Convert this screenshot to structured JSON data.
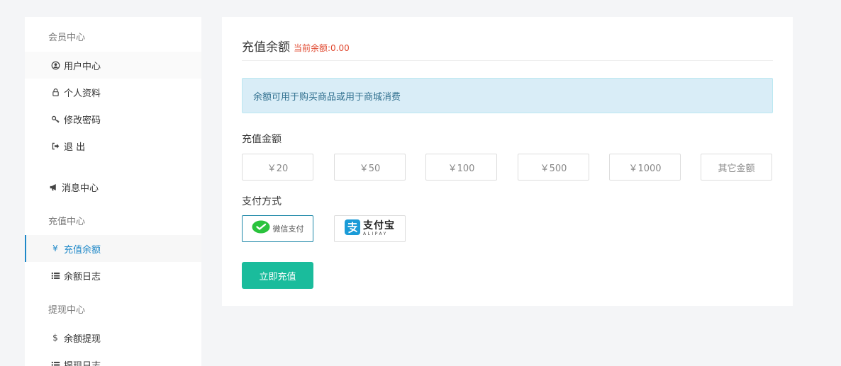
{
  "sidebar": {
    "sections": [
      {
        "title": "会员中心",
        "items": [
          {
            "label": "用户中心",
            "icon": "user-circle-icon"
          },
          {
            "label": "个人资料",
            "icon": "lock-icon"
          },
          {
            "label": "修改密码",
            "icon": "key-icon"
          },
          {
            "label": "退 出",
            "icon": "sign-out-icon"
          }
        ]
      },
      {
        "title": "",
        "items": [
          {
            "label": "消息中心",
            "icon": "bullhorn-icon"
          }
        ]
      },
      {
        "title": "充值中心",
        "items": [
          {
            "label": "充值余额",
            "icon": "yen-icon",
            "glyph": "¥"
          },
          {
            "label": "余额日志",
            "icon": "list-icon"
          }
        ]
      },
      {
        "title": "提现中心",
        "items": [
          {
            "label": "余额提现",
            "icon": "dollar-icon",
            "glyph": "$"
          },
          {
            "label": "提现日志",
            "icon": "list-icon"
          }
        ]
      }
    ]
  },
  "main": {
    "title": "充值余额",
    "balance_text": "当前余额:0.00",
    "notice": "余额可用于购买商品或用于商城消费",
    "amount_label": "充值金额",
    "amounts": [
      "￥20",
      "￥50",
      "￥100",
      "￥500",
      "￥1000",
      "其它金额"
    ],
    "payment_label": "支付方式",
    "payments": {
      "wechat": "微信支付",
      "alipay_cn": "支付宝",
      "alipay_en": "ALIPAY"
    },
    "submit_label": "立即充值"
  },
  "colors": {
    "accent": "#1e88c8",
    "submit": "#1abc9c",
    "balance": "#e0482f",
    "notice_bg": "#d9edf7",
    "wechat": "#2ac33d",
    "alipay": "#1a9bd7"
  }
}
